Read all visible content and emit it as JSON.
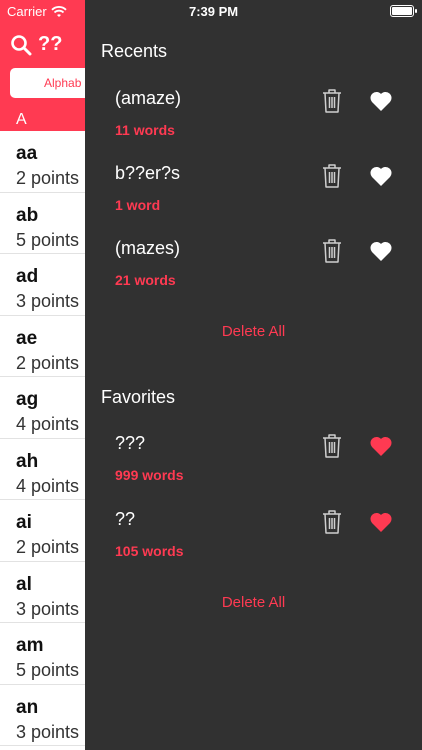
{
  "status": {
    "carrier": "Carrier",
    "time": "7:39 PM"
  },
  "search": {
    "query": "??"
  },
  "segment": {
    "label": "Alphab"
  },
  "list": {
    "section": "A",
    "rows": [
      {
        "word": "aa",
        "points": "2 points"
      },
      {
        "word": "ab",
        "points": "5 points"
      },
      {
        "word": "ad",
        "points": "3 points"
      },
      {
        "word": "ae",
        "points": "2 points"
      },
      {
        "word": "ag",
        "points": "4 points"
      },
      {
        "word": "ah",
        "points": "4 points"
      },
      {
        "word": "ai",
        "points": "2 points"
      },
      {
        "word": "al",
        "points": "3 points"
      },
      {
        "word": "am",
        "points": "5 points"
      },
      {
        "word": "an",
        "points": "3 points"
      }
    ]
  },
  "drawer": {
    "recents": {
      "title": "Recents",
      "items": [
        {
          "title": "(amaze)",
          "count": "11 words"
        },
        {
          "title": "b??er?s",
          "count": "1 word"
        },
        {
          "title": "(mazes)",
          "count": "21 words"
        }
      ],
      "delete_all": "Delete All"
    },
    "favorites": {
      "title": "Favorites",
      "items": [
        {
          "title": "???",
          "count": "999 words"
        },
        {
          "title": "??",
          "count": "105 words"
        }
      ],
      "delete_all": "Delete All"
    }
  },
  "colors": {
    "accent": "#ff3a52",
    "drawer_bg": "#313131"
  }
}
